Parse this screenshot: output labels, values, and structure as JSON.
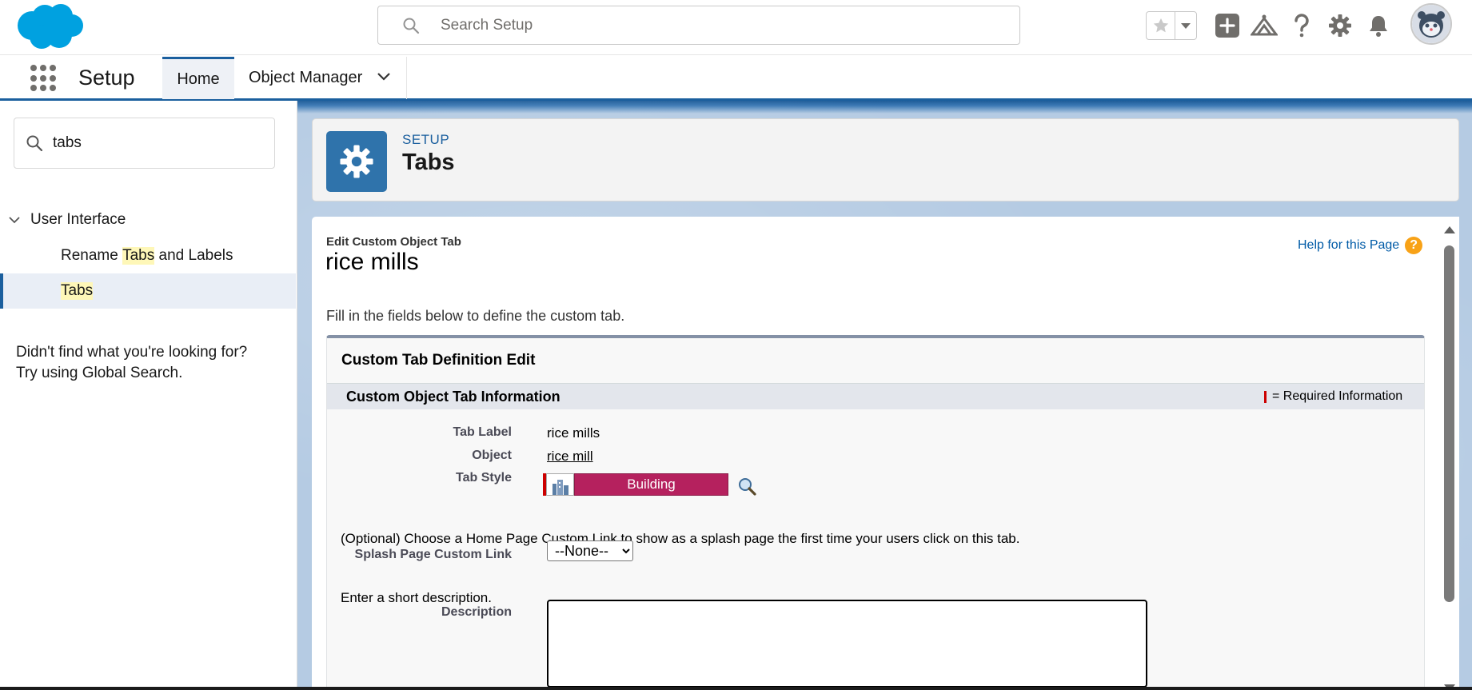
{
  "header": {
    "search_placeholder": "Search Setup",
    "brand_color": "#00a1e0",
    "icons": [
      "favorites-star-icon",
      "favorites-dropdown-icon",
      "global-actions-icon",
      "trailhead-icon",
      "help-icon",
      "setup-gear-icon",
      "notifications-bell-icon"
    ]
  },
  "context_bar": {
    "app_name": "Setup",
    "tabs": [
      {
        "label": "Home",
        "active": true
      },
      {
        "label": "Object Manager",
        "active": false
      }
    ]
  },
  "sidebar": {
    "quickfind_value": "tabs",
    "node_label": "User Interface",
    "items": [
      {
        "pre": "Rename ",
        "hl": "Tabs",
        "post": " and Labels",
        "selected": false
      },
      {
        "pre": "",
        "hl": "Tabs",
        "post": "",
        "selected": true
      }
    ],
    "help_line1": "Didn't find what you're looking for?",
    "help_line2": "Try using Global Search."
  },
  "page_header": {
    "breadcrumb": "SETUP",
    "title": "Tabs"
  },
  "content": {
    "subtitle": "Edit Custom Object Tab",
    "record_title": "rice mills",
    "help_link": "Help for this Page",
    "intro": "Fill in the fields below to define the custom tab.",
    "block_title": "Custom Tab Definition Edit",
    "section_title": "Custom Object Tab Information",
    "required_legend": "= Required Information",
    "fields": {
      "tab_label": {
        "label": "Tab Label",
        "value": "rice mills"
      },
      "object": {
        "label": "Object",
        "value": "rice mill"
      },
      "tab_style": {
        "label": "Tab Style",
        "value": "Building",
        "color": "#b5215e"
      }
    },
    "optional_text": "(Optional) Choose a Home Page Custom Link to show as a splash page the first time your users click on this tab.",
    "splash": {
      "label": "Splash Page Custom Link",
      "value": "--None--"
    },
    "description_prompt": "Enter a short description.",
    "description_label": "Description",
    "description_value": ""
  }
}
